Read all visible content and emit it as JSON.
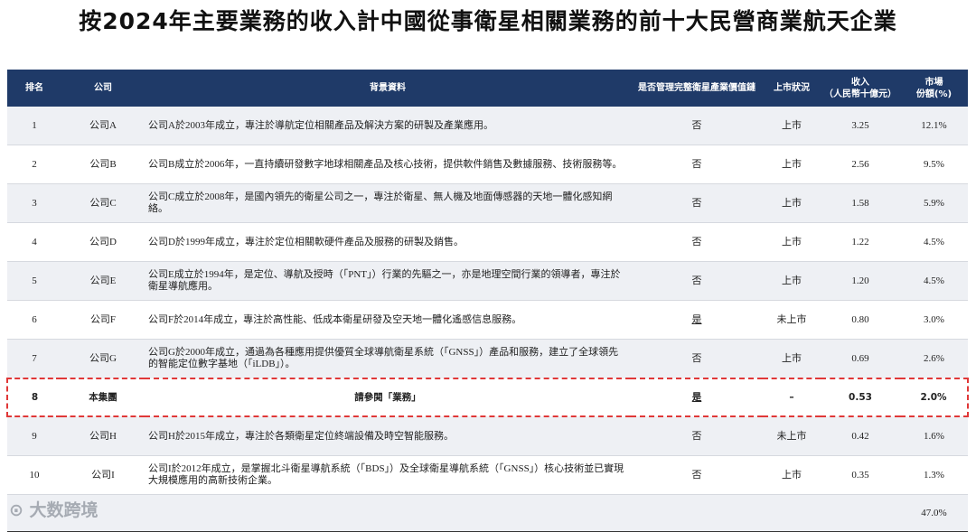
{
  "title": "按2024年主要業務的收入計中國從事衛星相關業務的前十大民營商業航天企業",
  "headers": {
    "rank": "排名",
    "company": "公司",
    "background": "背景資料",
    "full_chain": "是否管理完整衛星產業價值鏈",
    "listing": "上市狀況",
    "revenue_l1": "收入",
    "revenue_l2": "（人民幣十億元）",
    "share_l1": "市場",
    "share_l2": "份額(%)"
  },
  "rows": [
    {
      "rank": "1",
      "company": "公司A",
      "bg": "公司A於2003年成立，專注於導航定位相關產品及解決方案的研製及產業應用。",
      "chain": "否",
      "listed": "上市",
      "revenue": "3.25",
      "share": "12.1%"
    },
    {
      "rank": "2",
      "company": "公司B",
      "bg": "公司B成立於2006年，一直持續研發數字地球相關產品及核心技術，提供軟件銷售及數據服務、技術服務等。",
      "chain": "否",
      "listed": "上市",
      "revenue": "2.56",
      "share": "9.5%"
    },
    {
      "rank": "3",
      "company": "公司C",
      "bg": "公司C成立於2008年，是國內領先的衛星公司之一，專注於衛星、無人機及地面傳感器的天地一體化感知網絡。",
      "chain": "否",
      "listed": "上市",
      "revenue": "1.58",
      "share": "5.9%"
    },
    {
      "rank": "4",
      "company": "公司D",
      "bg": "公司D於1999年成立，專注於定位相關軟硬件產品及服務的研製及銷售。",
      "chain": "否",
      "listed": "上市",
      "revenue": "1.22",
      "share": "4.5%"
    },
    {
      "rank": "5",
      "company": "公司E",
      "bg": "公司E成立於1994年，是定位、導航及授時（「PNT」）行業的先驅之一，亦是地理空間行業的領導者，專注於衛星導航應用。",
      "chain": "否",
      "listed": "上市",
      "revenue": "1.20",
      "share": "4.5%"
    },
    {
      "rank": "6",
      "company": "公司F",
      "bg": "公司F於2014年成立，專注於高性能、低成本衛星研發及空天地一體化遙感信息服務。",
      "chain": "是",
      "listed": "未上市",
      "revenue": "0.80",
      "share": "3.0%"
    },
    {
      "rank": "7",
      "company": "公司G",
      "bg": "公司G於2000年成立，通過為各種應用提供優質全球導航衛星系統（「GNSS」）產品和服務，建立了全球領先的智能定位數字基地（「iLDB」）。",
      "chain": "否",
      "listed": "上市",
      "revenue": "0.69",
      "share": "2.6%"
    },
    {
      "rank": "8",
      "company": "本集團",
      "bg": "請參閱「業務」",
      "chain": "是",
      "listed": "–",
      "revenue": "0.53",
      "share": "2.0%"
    },
    {
      "rank": "9",
      "company": "公司H",
      "bg": "公司H於2015年成立，專注於各類衛星定位終端設備及時空智能服務。",
      "chain": "否",
      "listed": "未上市",
      "revenue": "0.42",
      "share": "1.6%"
    },
    {
      "rank": "10",
      "company": "公司I",
      "bg": "公司I於2012年成立，是掌握北斗衛星導航系統（「BDS」）及全球衛星導航系統（「GNSS」）核心技術並已實現大規模應用的高新技術企業。",
      "chain": "否",
      "listed": "上市",
      "revenue": "0.35",
      "share": "1.3%"
    }
  ],
  "total": {
    "share": "47.0%"
  },
  "watermark": "大数跨境"
}
